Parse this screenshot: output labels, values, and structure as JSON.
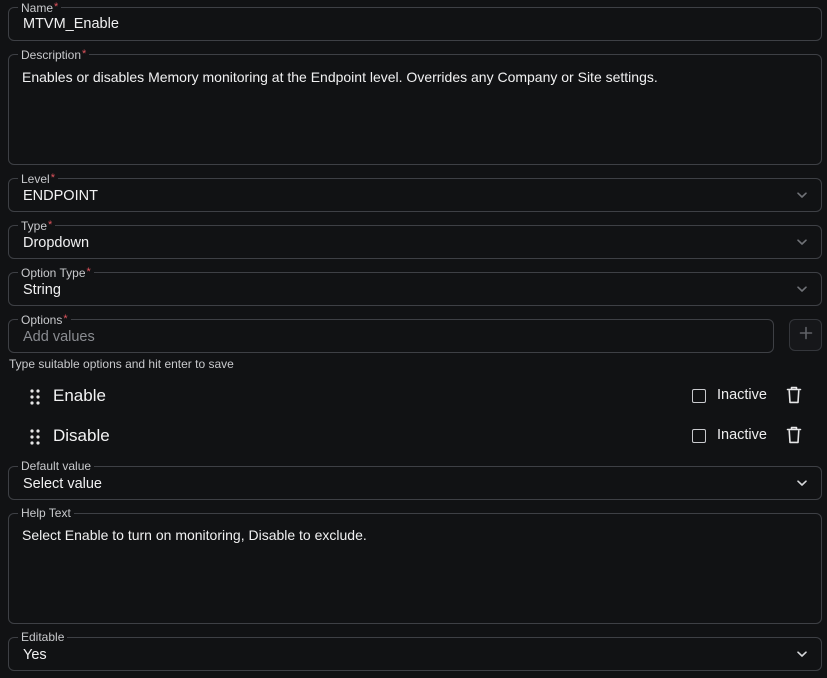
{
  "form": {
    "name": {
      "label": "Name",
      "required": "*",
      "value": "MTVM_Enable"
    },
    "description": {
      "label": "Description",
      "required": "*",
      "value": "Enables or disables Memory monitoring at the Endpoint level. Overrides any Company or Site settings."
    },
    "level": {
      "label": "Level",
      "required": "*",
      "value": "ENDPOINT"
    },
    "type": {
      "label": "Type",
      "required": "*",
      "value": "Dropdown"
    },
    "option_type": {
      "label": "Option Type",
      "required": "*",
      "value": "String"
    },
    "options": {
      "label": "Options",
      "required": "*",
      "placeholder": "Add values",
      "hint": "Type suitable options and hit enter to save"
    },
    "option_items": [
      {
        "label": "Enable",
        "status_label": "Inactive",
        "checked": false
      },
      {
        "label": "Disable",
        "status_label": "Inactive",
        "checked": false
      }
    ],
    "default_value": {
      "label": "Default value",
      "value": "Select value"
    },
    "help_text": {
      "label": "Help Text",
      "value": "Select Enable to turn on monitoring, Disable to exclude."
    },
    "editable": {
      "label": "Editable",
      "value": "Yes"
    }
  },
  "icons": {
    "chevron": "chevron-down-icon",
    "add": "plus-icon",
    "drag": "drag-handle-icon",
    "delete": "trash-icon"
  },
  "colors": {
    "background": "#111214",
    "border": "#3e4045",
    "required": "#e0545d",
    "text": "#f1f1f2",
    "muted": "#8a8c91"
  }
}
